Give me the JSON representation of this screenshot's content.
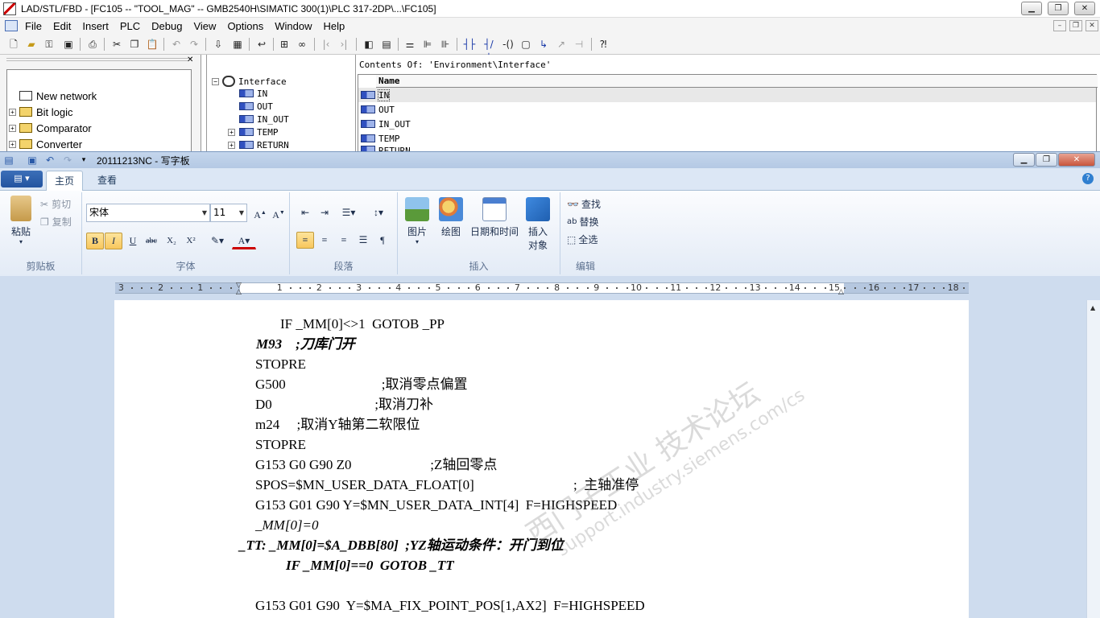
{
  "step7": {
    "title": "LAD/STL/FBD  - [FC105 -- \"TOOL_MAG\" -- GMB2540H\\SIMATIC 300(1)\\PLC 317-2DP\\...\\FC105]",
    "menu": [
      "File",
      "Edit",
      "Insert",
      "PLC",
      "Debug",
      "View",
      "Options",
      "Window",
      "Help"
    ],
    "catalog": [
      "New network",
      "Bit logic",
      "Comparator",
      "Converter"
    ],
    "interface_tree": {
      "root": "Interface",
      "children": [
        "IN",
        "OUT",
        "IN_OUT",
        "TEMP",
        "RETURN"
      ]
    },
    "contents_header": "Contents Of: 'Environment\\Interface'",
    "table_column": "Name",
    "table_rows": [
      "IN",
      "OUT",
      "IN_OUT",
      "TEMP",
      "RETURN"
    ]
  },
  "wordpad": {
    "title": "20111213NC - 写字板",
    "tabs": [
      "主页",
      "查看"
    ],
    "groups": {
      "clipboard": {
        "label": "剪贴板",
        "paste": "粘贴",
        "cut": "剪切",
        "copy": "复制"
      },
      "font": {
        "label": "字体",
        "name": "宋体",
        "size": "11"
      },
      "paragraph": {
        "label": "段落"
      },
      "insert": {
        "label": "插入",
        "picture": "图片",
        "paint": "绘图",
        "datetime": "日期和时间",
        "object_1": "插入",
        "object_2": "对象"
      },
      "editing": {
        "label": "编辑",
        "find": "查找",
        "replace": "替换",
        "select_all": "全选"
      }
    },
    "ruler_numbers": [
      "3",
      "2",
      "1",
      "1",
      "2",
      "3",
      "4",
      "5",
      "6",
      "7",
      "8",
      "9",
      "10",
      "11",
      "12",
      "13",
      "14",
      "15",
      "16",
      "17",
      "18"
    ],
    "document_lines": [
      {
        "text": "IF _MM[0]<>1  GOTOB _PP",
        "style": "normal"
      },
      {
        "text": "M93    ;刀库门开",
        "style": "bold-italic"
      },
      {
        "text": "STOPRE",
        "style": "normal"
      },
      {
        "text": "G500                            ;取消零点偏置",
        "style": "normal"
      },
      {
        "text": "D0                              ;取消刀补",
        "style": "normal"
      },
      {
        "text": "m24     ;取消Y轴第二软限位",
        "style": "normal"
      },
      {
        "text": "STOPRE",
        "style": "normal"
      },
      {
        "text": "G153 G0 G90 Z0                       ;Z轴回零点",
        "style": "normal"
      },
      {
        "text": "SPOS=$MN_USER_DATA_FLOAT[0]                             ;  主轴准停",
        "style": "normal"
      },
      {
        "text": "G153 G01 G90 Y=$MN_USER_DATA_INT[4]  F=HIGHSPEED",
        "style": "normal"
      },
      {
        "text": "_MM[0]=0",
        "style": "italic"
      },
      {
        "text": "_TT: _MM[0]=$A_DBB[80]  ;YZ轴运动条件：开门到位",
        "style": "bold-italic"
      },
      {
        "text": "IF _MM[0]==0  GOTOB _TT",
        "style": "bold-italic"
      },
      {
        "text": "",
        "style": "normal"
      },
      {
        "text": "G153 G01 G90  Y=$MA_FIX_POINT_POS[1,AX2]  F=HIGHSPEED",
        "style": "normal"
      }
    ],
    "watermark": [
      "西门子工业 技术论坛",
      "support.industry.siemens.com/cs"
    ]
  }
}
